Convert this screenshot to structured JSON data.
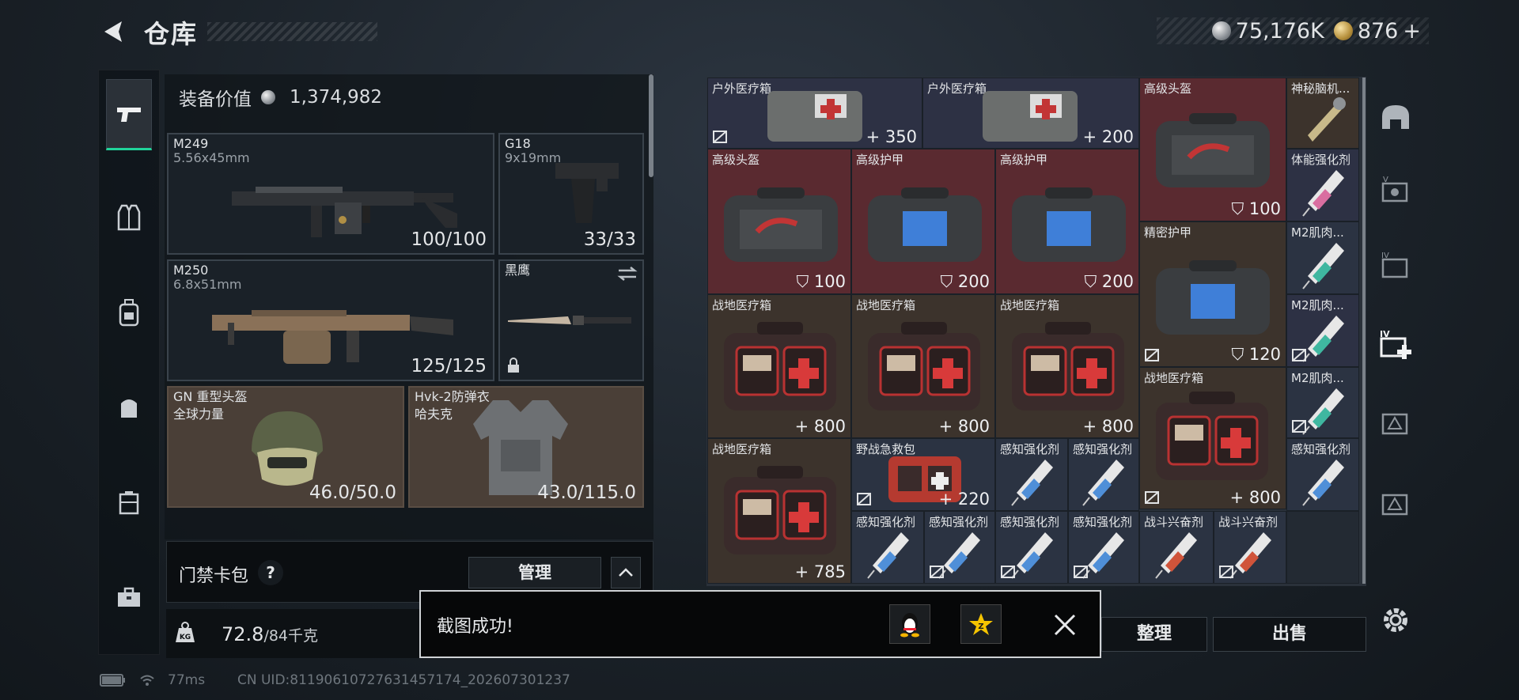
{
  "header": {
    "title": "仓库"
  },
  "currency": {
    "silver": "75,176K",
    "gold": "876",
    "gold_add": "+"
  },
  "equipment": {
    "value_label": "装备价值",
    "value": "1,374,982",
    "primary": {
      "name": "M249",
      "ammo": "5.56x45mm",
      "durability": "100/100"
    },
    "secondary": {
      "name": "G18",
      "ammo": "9x19mm",
      "durability": "33/33"
    },
    "tertiary": {
      "name": "M250",
      "ammo": "6.8x51mm",
      "durability": "125/125"
    },
    "melee": {
      "name": "黑鹰"
    },
    "helmet": {
      "name": "GN 重型头盔",
      "brand": "全球力量",
      "durability": "46.0/50.0"
    },
    "armor": {
      "name": "Hvk-2防弹衣",
      "brand": "哈夫克",
      "durability": "43.0/115.0"
    }
  },
  "card_pack": {
    "label": "门禁卡包",
    "help": "?",
    "manage": "管理"
  },
  "weight": {
    "current": "72.8",
    "max": "/84千克",
    "badge": "KG"
  },
  "inventory": {
    "cells": [
      {
        "name": "户外医疗箱",
        "value": "350",
        "prefix": "+"
      },
      {
        "name": "户外医疗箱",
        "value": "200",
        "prefix": "+"
      },
      {
        "name": "高级头盔",
        "value": "100"
      },
      {
        "name": "神秘脑机..."
      },
      {
        "name": "高级头盔",
        "value": "100"
      },
      {
        "name": "高级护甲",
        "value": "200"
      },
      {
        "name": "高级护甲",
        "value": "200"
      },
      {
        "name": "体能强化剂"
      },
      {
        "name": "精密护甲",
        "value": "120"
      },
      {
        "name": "M2肌肉..."
      },
      {
        "name": "战地医疗箱",
        "value": "800",
        "prefix": "+"
      },
      {
        "name": "战地医疗箱",
        "value": "800",
        "prefix": "+"
      },
      {
        "name": "战地医疗箱",
        "value": "800",
        "prefix": "+"
      },
      {
        "name": "M2肌肉..."
      },
      {
        "name": "战地医疗箱",
        "value": "800",
        "prefix": "+"
      },
      {
        "name": "M2肌肉..."
      },
      {
        "name": "战地医疗箱",
        "value": "785",
        "prefix": "+"
      },
      {
        "name": "野战急救包",
        "value": "220",
        "prefix": "+"
      },
      {
        "name": "感知强化剂"
      },
      {
        "name": "感知强化剂"
      },
      {
        "name": "感知强化剂"
      },
      {
        "name": "感知强化剂"
      },
      {
        "name": "感知强化剂"
      },
      {
        "name": "感知强化剂"
      },
      {
        "name": "感知强化剂"
      },
      {
        "name": "战斗兴奋剂"
      },
      {
        "name": "战斗兴奋剂"
      }
    ]
  },
  "actions": {
    "sort": "整理",
    "sell": "出售"
  },
  "toast": {
    "message": "截图成功!"
  },
  "status": {
    "battery_icon": "battery-icon",
    "ping": "77ms",
    "uid": "CN UID:8119061072763145717​4_202607301237"
  },
  "colors": {
    "accent_green": "#20d39a",
    "rarity_red": "#5a2a30",
    "rarity_navy": "#2d3144",
    "rarity_brown": "#3c332c"
  }
}
